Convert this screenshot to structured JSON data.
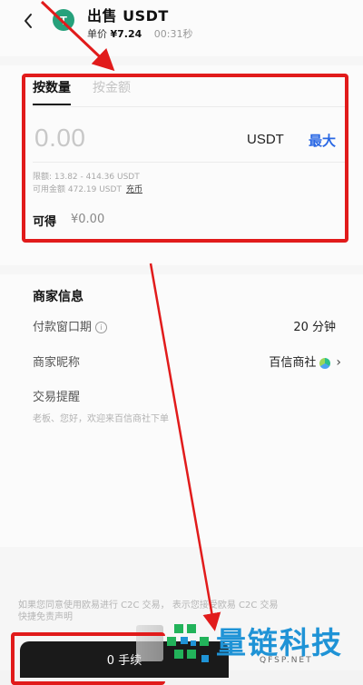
{
  "header": {
    "title": "出售 USDT",
    "price_label": "单价",
    "price_value": "¥7.24",
    "timer": "00:31秒",
    "coin_symbol": "T"
  },
  "order": {
    "tabs": [
      {
        "label": "按数量",
        "active": true
      },
      {
        "label": "按金额",
        "active": false
      }
    ],
    "amount_placeholder": "0.00",
    "unit": "USDT",
    "max_label": "最大",
    "limit_text": "限额: 13.82 - 414.36 USDT",
    "available_text": "可用金额 472.19 USDT",
    "recharge_label": "充币",
    "receive_label": "可得",
    "receive_value": "¥0.00"
  },
  "merchant": {
    "section_title": "商家信息",
    "payment_window_label": "付款窗口期",
    "payment_window_value": "20 分钟",
    "nickname_label": "商家昵称",
    "nickname_value": "百信商社",
    "remind_label": "交易提醒",
    "remind_text": "老板、您好，欢迎来百信商社下单"
  },
  "footer": {
    "disclaimer_line1": "如果您同意使用欧易进行 C2C 交易，   表示您接受欧易 C2C 交易",
    "disclaimer_line2": "快捷免责声明",
    "action_button": "0 手续"
  },
  "watermark": {
    "brand": "量链科技",
    "domain": "QFSP.NET"
  },
  "colors": {
    "accent_blue": "#2a68e4",
    "highlight_red": "#e11b1b",
    "coin_green": "#26a17b",
    "watermark_blue": "#1f93d6"
  }
}
